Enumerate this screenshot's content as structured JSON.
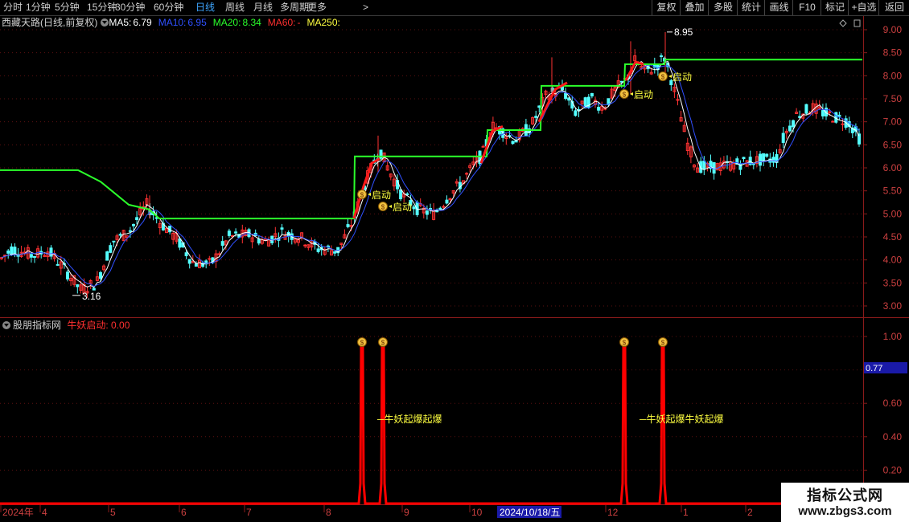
{
  "toolbar": {
    "periods": [
      "分时",
      "1分钟",
      "5分钟",
      "15分钟",
      "30分钟",
      "60分钟",
      "日线",
      "周线",
      "月线",
      "多周期",
      "更多"
    ],
    "active_period": "日线",
    "right_buttons": [
      "复权",
      "叠加",
      "多股",
      "统计",
      "画线",
      "F10",
      "标记",
      "+自选",
      "返回"
    ]
  },
  "main_chart": {
    "stock_label": "西藏天路(日线,前复权)",
    "ma_indicators": [
      {
        "label": "MA5:",
        "value": "6.79",
        "color": "#ffffff"
      },
      {
        "label": "MA10:",
        "value": "6.95",
        "color": "#3050ff"
      },
      {
        "label": "MA20:",
        "value": "8.34",
        "color": "#2bff2b"
      },
      {
        "label": "MA60:",
        "value": "-",
        "color": "#ff3030"
      },
      {
        "label": "MA250:",
        "value": "",
        "color": "#ffff40"
      }
    ],
    "price_axis_labels": [
      "9.00",
      "8.50",
      "8.00",
      "7.50",
      "7.00",
      "6.50",
      "6.00",
      "5.50",
      "5.00",
      "4.50",
      "4.00",
      "3.50",
      "3.00"
    ],
    "high_label": "8.95",
    "low_label": "3.16",
    "signal_text": "启动",
    "signal_icon": "money-bag-icon"
  },
  "sub_chart": {
    "indicator_name": "股朋指标网",
    "formula_label": "牛妖启动:",
    "formula_value": "0.00",
    "axis_labels": [
      "1.00",
      "0.80",
      "0.60",
      "0.40",
      "0.20"
    ],
    "current_value_badge": "0.77",
    "annotations": [
      "─牛妖起爆起爆",
      "─牛妖起爆牛妖起爆"
    ]
  },
  "time_axis": {
    "labels": [
      "2024年",
      "4",
      "5",
      "6",
      "7",
      "8",
      "9",
      "10",
      "12",
      "1",
      "2"
    ],
    "cursor_date": "2024/10/18/五"
  },
  "watermark": {
    "line1": "指标公式网",
    "line2": "www.zbgs3.com"
  },
  "colors": {
    "up_candle": "#ff3232",
    "down_candle": "#54ffff",
    "ma5": "#ffffff",
    "ma10": "#3050ff",
    "ma20_green_line": "#2bff2b",
    "signal_text": "#ffff40",
    "sub_line": "#ff0000",
    "cursor_box": "#1a1aa8"
  }
}
